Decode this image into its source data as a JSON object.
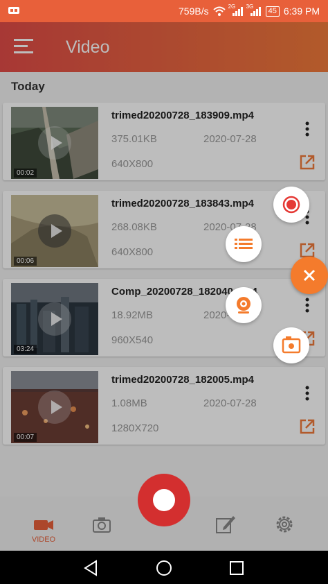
{
  "status_bar": {
    "network_speed": "759B/s",
    "battery": "45",
    "time": "6:39 PM",
    "signal_1_label": "2G",
    "signal_2_label": "3G"
  },
  "app_bar": {
    "title": "Video",
    "menu_icon": "hamburger-menu-icon"
  },
  "section": {
    "title": "Today"
  },
  "videos": [
    {
      "name": "trimed20200728_183909.mp4",
      "size": "375.01KB",
      "date": "2020-07-28",
      "resolution": "640X800",
      "duration": "00:02"
    },
    {
      "name": "trimed20200728_183843.mp4",
      "size": "268.08KB",
      "date": "2020-07-28",
      "resolution": "640X800",
      "duration": "00:06"
    },
    {
      "name": "Comp_20200728_182040.mp4",
      "size": "18.92MB",
      "date": "2020-07-28",
      "resolution": "960X540",
      "duration": "03:24"
    },
    {
      "name": "trimed20200728_182005.mp4",
      "size": "1.08MB",
      "date": "2020-07-28",
      "resolution": "1280X720",
      "duration": "00:07"
    }
  ],
  "bottom_nav": {
    "items": [
      {
        "label": "VIDEO",
        "icon": "video-camera-icon",
        "active": true
      },
      {
        "label": "",
        "icon": "camera-icon",
        "active": false
      },
      {
        "label": "",
        "icon": "edit-icon",
        "active": false
      },
      {
        "label": "",
        "icon": "settings-gear-icon",
        "active": false
      }
    ]
  },
  "floating_menu": {
    "items": [
      "record-icon",
      "list-icon",
      "webcam-icon",
      "screenshot-icon"
    ],
    "close_icon": "close-icon"
  },
  "colors": {
    "accent": "#e8603a",
    "record_red": "#d32f2f",
    "fab_orange": "#f47b2c",
    "link_orange": "#f07a3a"
  }
}
